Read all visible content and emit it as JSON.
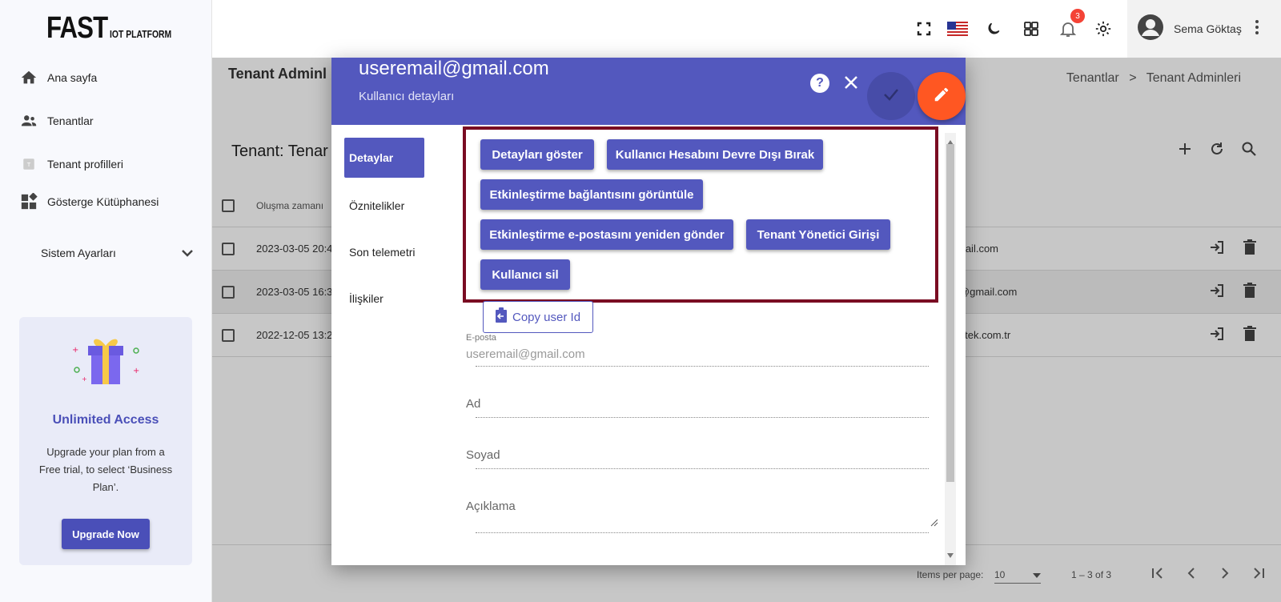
{
  "brand": {
    "logo_big": "FAST",
    "logo_small": "IOT PLATFORM"
  },
  "sidebar": {
    "items": [
      {
        "label": "Ana sayfa",
        "icon": "home-icon"
      },
      {
        "label": "Tenantlar",
        "icon": "people-icon"
      },
      {
        "label": "Tenant profilleri",
        "icon": "profile-icon"
      },
      {
        "label": "Gösterge Kütüphanesi",
        "icon": "dashboard-icon"
      }
    ],
    "settings_label": "Sistem Ayarları",
    "promo": {
      "title": "Unlimited Access",
      "text": "Upgrade your plan from a Free trial, to select ‘Business Plan’.",
      "button": "Upgrade Now"
    }
  },
  "topbar": {
    "notification_count": "3",
    "user_name": "Sema Göktaş"
  },
  "main": {
    "page_title": "Tenant Adminl",
    "breadcrumb": {
      "first": "Tenantlar",
      "separator": ">",
      "second": "Tenant Adminleri"
    },
    "table_title": "Tenant: Tenar",
    "column_created": "Oluşma zamanı",
    "rows": [
      {
        "date": "2023-03-05 20:4",
        "email": "mail.com"
      },
      {
        "date": "2023-03-05 16:3",
        "email": "l@gmail.com"
      },
      {
        "date": "2022-12-05 13:2",
        "email": "oltek.com.tr"
      }
    ],
    "pager": {
      "items_per_page_label": "Items per page:",
      "items_per_page_value": "10",
      "range": "1 – 3 of 3"
    }
  },
  "dialog": {
    "title": "useremail@gmail.com",
    "subtitle": "Kullanıcı detayları",
    "help": "?",
    "tabs": [
      "Detaylar",
      "Öznitelikler",
      "Son telemetri",
      "İlişkiler"
    ],
    "actions": {
      "show_details": "Detayları göster",
      "disable_account": "Kullanıcı Hesabını Devre Dışı Bırak",
      "show_activation_link": "Etkinleştirme bağlantısını görüntüle",
      "resend_activation": "Etkinleştirme e-postasını yeniden gönder",
      "tenant_admin_login": "Tenant Yönetici Girişi",
      "delete_user": "Kullanıcı sil"
    },
    "copy_user_id": "Copy user Id",
    "fields": {
      "email_label": "E-posta",
      "email_value": "useremail@gmail.com",
      "first_name": "Ad",
      "last_name": "Soyad",
      "description": "Açıklama"
    }
  },
  "colors": {
    "primary": "#5358be",
    "accent": "#ff5722",
    "highlight_border": "#7a0c22"
  }
}
